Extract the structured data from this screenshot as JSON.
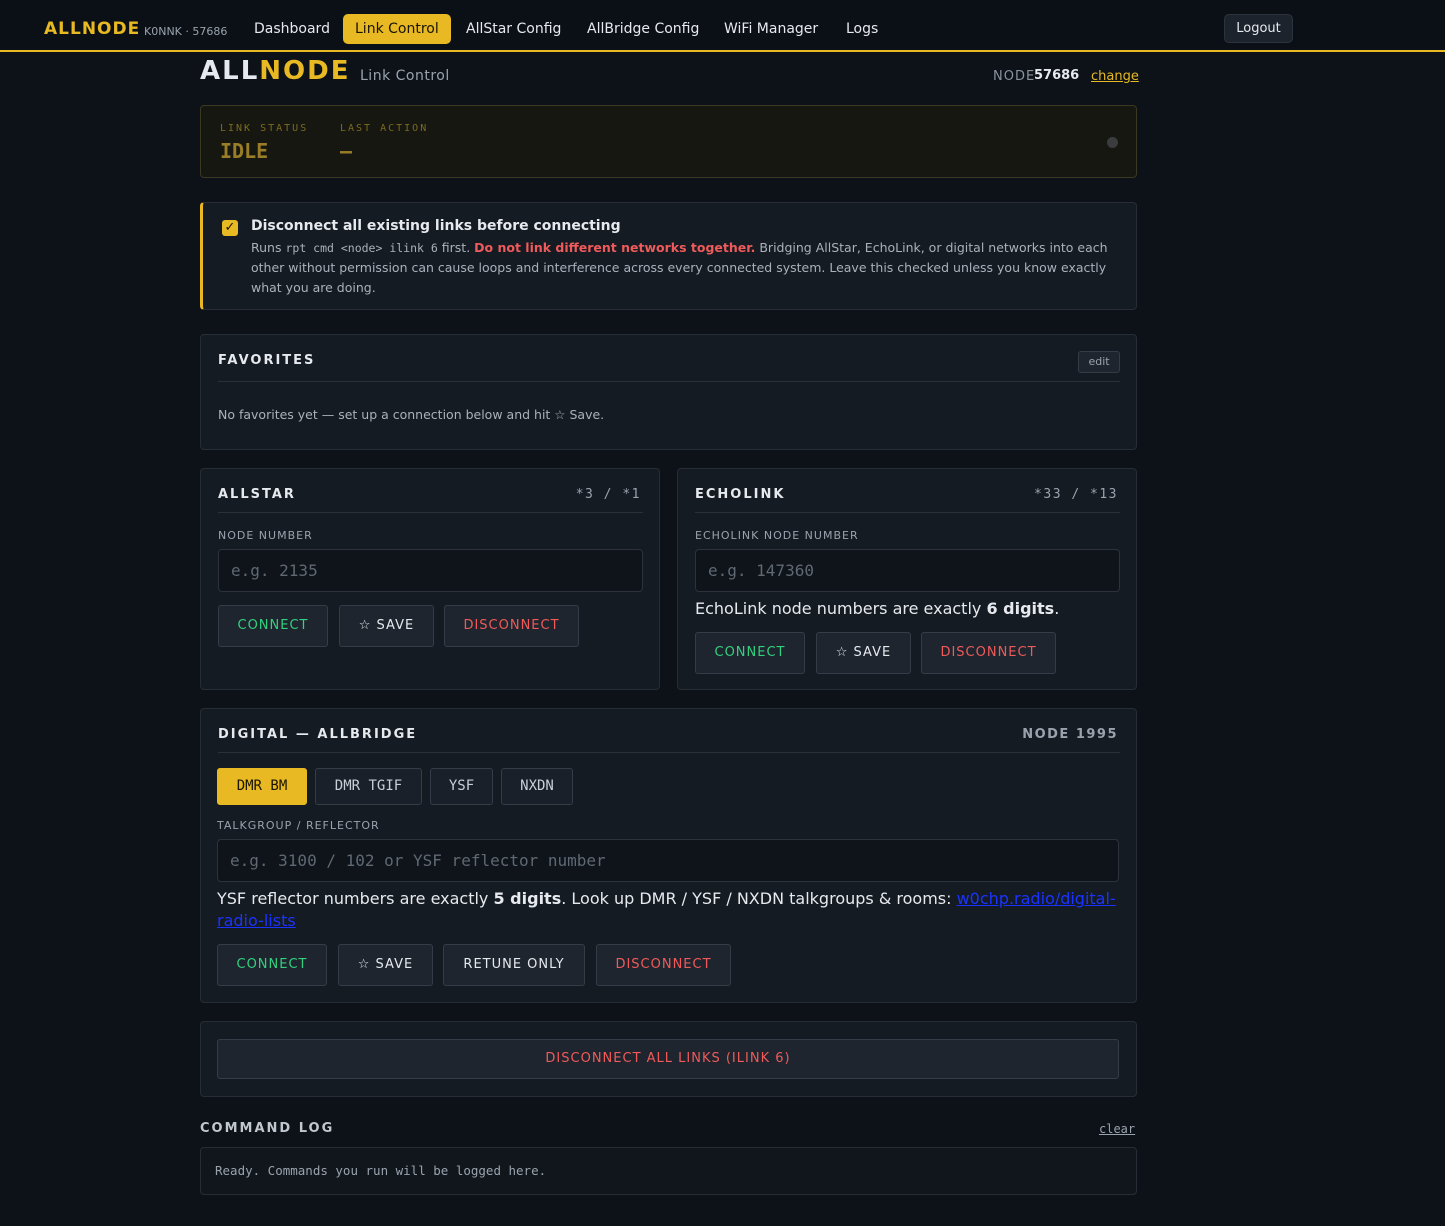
{
  "nav": {
    "brand": "ALLNODE",
    "callsign": "K0NNK · 57686",
    "links": [
      "Dashboard",
      "Link Control",
      "AllStar Config",
      "AllBridge Config",
      "WiFi Manager",
      "Logs"
    ],
    "logout": "Logout"
  },
  "header": {
    "brand_a": "ALL",
    "brand_b": "NODE",
    "subtitle": "Link Control",
    "node_label": "NODE",
    "node_number": "57686",
    "change": "change"
  },
  "status": {
    "link_status_label": "LINK STATUS",
    "link_status_value": "IDLE",
    "last_action_label": "LAST ACTION",
    "last_action_value": "—"
  },
  "warning": {
    "checked": true,
    "title": "Disconnect all existing links before connecting",
    "runs": "Runs",
    "code": "rpt cmd <node> ilink 6",
    "first": "first.",
    "danger": "Do not link different networks together.",
    "body": "Bridging AllStar, EchoLink, or digital networks into each other without permission can cause loops and interference across every connected system. Leave this checked unless you know exactly what you are doing."
  },
  "favorites": {
    "title": "FAVORITES",
    "edit": "edit",
    "empty": "No favorites yet — set up a connection below and hit ☆ Save."
  },
  "allstar": {
    "title": "ALLSTAR",
    "codes": "*3 / *1",
    "field_label": "NODE NUMBER",
    "placeholder": "e.g. 2135",
    "connect": "CONNECT",
    "save": "☆ SAVE",
    "disconnect": "DISCONNECT"
  },
  "echolink": {
    "title": "ECHOLINK",
    "codes": "*33 / *13",
    "field_label": "ECHOLINK NODE NUMBER",
    "placeholder": "e.g. 147360",
    "hint_a": "EchoLink node numbers are exactly ",
    "hint_b": "6 digits",
    "hint_c": ".",
    "connect": "CONNECT",
    "save": "☆ SAVE",
    "disconnect": "DISCONNECT"
  },
  "digital": {
    "title": "DIGITAL — ALLBRIDGE",
    "node": "NODE 1995",
    "modes": [
      "DMR BM",
      "DMR TGIF",
      "YSF",
      "NXDN"
    ],
    "active_mode": "DMR BM",
    "field_label": "TALKGROUP / REFLECTOR",
    "placeholder": "e.g. 3100 / 102 or YSF reflector number",
    "hint_a": "YSF reflector numbers are exactly ",
    "hint_b": "5 digits",
    "hint_c": ". Look up DMR / YSF / NXDN talkgroups & rooms: ",
    "link_line1": "w0chp.radio/digital-",
    "link_line2": "radio-lists",
    "connect": "CONNECT",
    "save": "☆ SAVE",
    "retune": "RETUNE ONLY",
    "disconnect": "DISCONNECT"
  },
  "disconnect_all": "DISCONNECT ALL LINKS (ILINK 6)",
  "log": {
    "title": "COMMAND LOG",
    "clear": "clear",
    "text": "Ready. Commands you run will be logged here."
  }
}
